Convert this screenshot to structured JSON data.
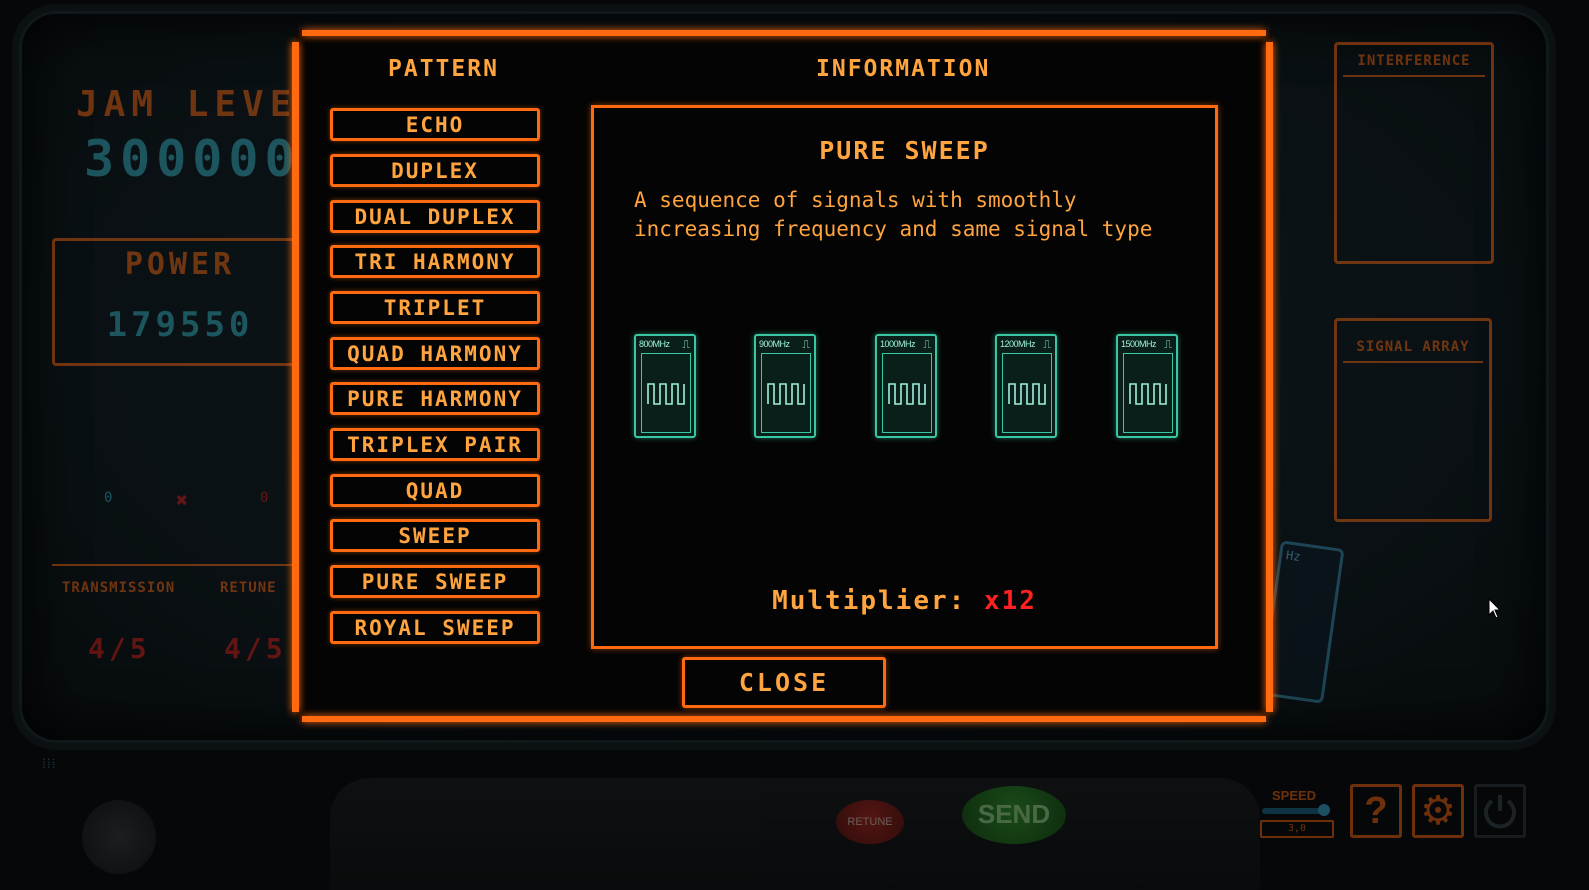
{
  "background": {
    "jam_level_label": "JAM LEVEL",
    "jam_level_value": "300000",
    "power_label": "POWER",
    "power_value": "179550",
    "counter_left": "0",
    "counter_right": "0",
    "transmission_label": "TRANSMISSION",
    "transmission_value": "4/5",
    "retune_label": "RETUNE",
    "retune_value": "4/5",
    "interference_label": "INTERFERENCE",
    "signal_array_label": "SIGNAL ARRAY",
    "peek_card_label": "Hz"
  },
  "modal": {
    "pattern_header": "PATTERN",
    "information_header": "INFORMATION",
    "patterns": [
      "ECHO",
      "DUPLEX",
      "DUAL DUPLEX",
      "TRI HARMONY",
      "TRIPLET",
      "QUAD HARMONY",
      "PURE HARMONY",
      "TRIPLEX PAIR",
      "QUAD",
      "SWEEP",
      "PURE SWEEP",
      "ROYAL SWEEP"
    ],
    "info": {
      "title": "PURE SWEEP",
      "description": "A sequence of signals with smoothly increasing frequency and same signal type",
      "signals": [
        {
          "freq": "800MHz",
          "type": "square"
        },
        {
          "freq": "900MHz",
          "type": "square"
        },
        {
          "freq": "1000MHz",
          "type": "square"
        },
        {
          "freq": "1200MHz",
          "type": "square"
        },
        {
          "freq": "1500MHz",
          "type": "square"
        }
      ],
      "multiplier_label": "Multiplier:",
      "multiplier_value": "x12"
    },
    "close_label": "CLOSE"
  },
  "console": {
    "retune_button": "RETUNE",
    "send_button": "SEND",
    "speed_label": "SPEED",
    "speed_value": "3,0",
    "help_icon": "question-icon",
    "settings_icon": "gear-icon",
    "power_icon": "power-icon"
  },
  "colors": {
    "accent": "#ff6a10",
    "text": "#ffa43e",
    "signal": "#39c6a2",
    "multiplier": "#ff2020"
  }
}
